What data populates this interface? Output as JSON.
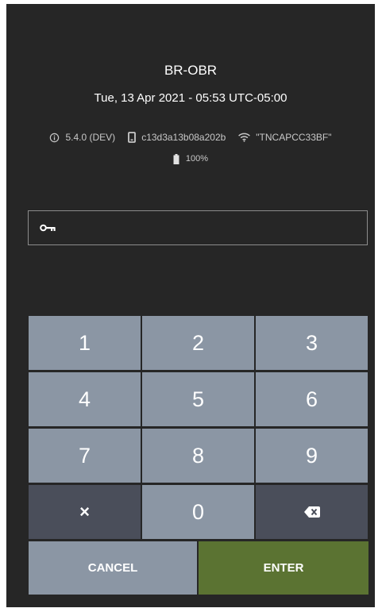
{
  "header": {
    "title": "BR-OBR",
    "datetime": "Tue, 13 Apr 2021 - 05:53 UTC-05:00"
  },
  "info": {
    "version": "5.4.0 (DEV)",
    "device_id": "c13d3a13b08a202b",
    "wifi": "\"TNCAPCC33BF\"",
    "battery": "100%"
  },
  "pin": {
    "value": "",
    "placeholder": ""
  },
  "keypad": {
    "k1": "1",
    "k2": "2",
    "k3": "3",
    "k4": "4",
    "k5": "5",
    "k6": "6",
    "k7": "7",
    "k8": "8",
    "k9": "9",
    "clear": "×",
    "k0": "0",
    "cancel": "CANCEL",
    "enter": "ENTER"
  },
  "colors": {
    "background": "#262626",
    "key": "#8b96a4",
    "key_dark": "#4a4e5a",
    "enter": "#5b7332"
  },
  "icons": {
    "version": "info-icon",
    "device": "phone-icon",
    "wifi": "wifi-icon",
    "battery": "battery-icon",
    "pin": "key-icon",
    "backspace": "backspace-icon"
  }
}
